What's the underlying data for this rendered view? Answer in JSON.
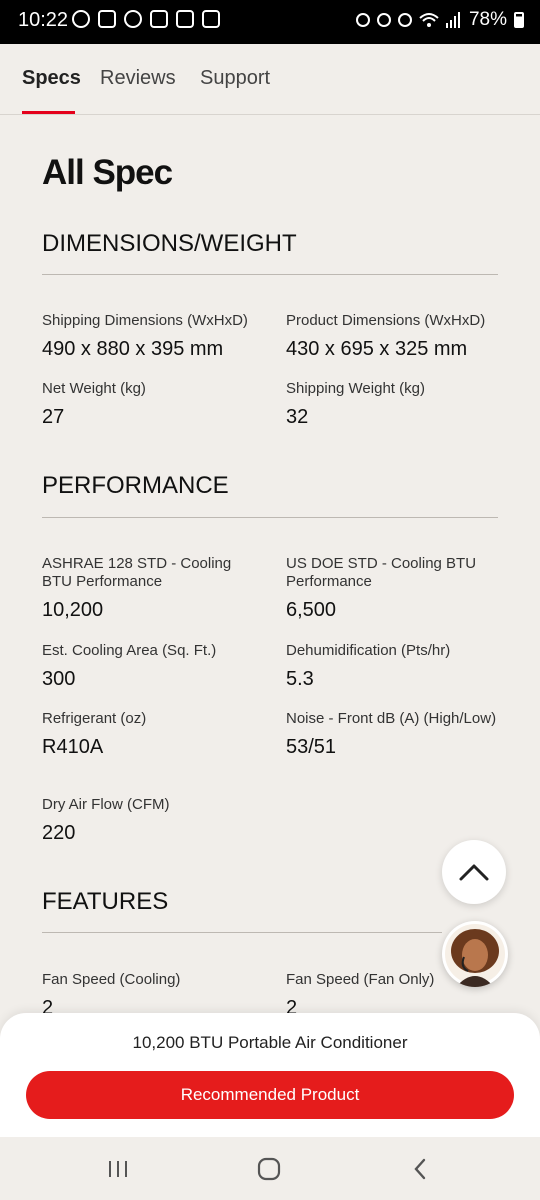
{
  "status_bar": {
    "time": "10:22",
    "battery": "78%"
  },
  "tabs": [
    {
      "label": "Specs",
      "active": true
    },
    {
      "label": "Reviews",
      "active": false
    },
    {
      "label": "Support",
      "active": false
    }
  ],
  "page_title": "All Spec",
  "sections": {
    "dimensions": {
      "title": "DIMENSIONS/WEIGHT",
      "specs": [
        {
          "label": "Shipping Dimensions (WxHxD)",
          "value": "490 x 880 x 395 mm"
        },
        {
          "label": "Product Dimensions (WxHxD)",
          "value": "430 x 695 x 325 mm"
        },
        {
          "label": "Net Weight (kg)",
          "value": "27"
        },
        {
          "label": "Shipping Weight (kg)",
          "value": "32"
        }
      ]
    },
    "performance": {
      "title": "PERFORMANCE",
      "specs": [
        {
          "label": "ASHRAE 128 STD - Cooling BTU Performance",
          "value": "10,200"
        },
        {
          "label": "US DOE STD - Cooling BTU Performance",
          "value": "6,500"
        },
        {
          "label": "Est. Cooling Area (Sq. Ft.)",
          "value": "300"
        },
        {
          "label": "Dehumidification (Pts/hr)",
          "value": "5.3"
        },
        {
          "label": "Refrigerant (oz)",
          "value": "R410A"
        },
        {
          "label": "Noise - Front dB (A) (High/Low)",
          "value": "53/51"
        },
        {
          "label": "Dry Air Flow (CFM)",
          "value": "220"
        }
      ]
    },
    "features": {
      "title": "FEATURES",
      "specs": [
        {
          "label": "Fan Speed (Cooling)",
          "value": "2"
        },
        {
          "label": "Fan Speed (Fan Only)",
          "value": "2"
        }
      ]
    }
  },
  "bottom_sheet": {
    "product_name": "10,200 BTU Portable Air Conditioner",
    "cta_label": "Recommended Product"
  },
  "colors": {
    "accent": "#e51c1c",
    "tab_indicator": "#e4001b",
    "background": "#f1eeea"
  },
  "icons": {
    "scroll_top": "chevron-up-icon",
    "chat": "chat-agent-avatar",
    "nav": [
      "recent-apps-icon",
      "home-icon",
      "back-icon"
    ]
  }
}
